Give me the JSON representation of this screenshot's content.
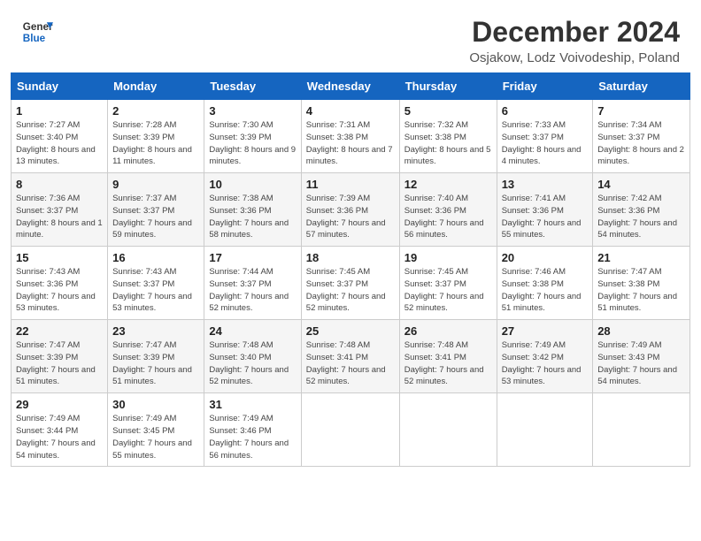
{
  "header": {
    "logo_general": "General",
    "logo_blue": "Blue",
    "title": "December 2024",
    "subtitle": "Osjakow, Lodz Voivodeship, Poland"
  },
  "days_of_week": [
    "Sunday",
    "Monday",
    "Tuesday",
    "Wednesday",
    "Thursday",
    "Friday",
    "Saturday"
  ],
  "weeks": [
    [
      {
        "day": "1",
        "detail": "Sunrise: 7:27 AM\nSunset: 3:40 PM\nDaylight: 8 hours\nand 13 minutes."
      },
      {
        "day": "2",
        "detail": "Sunrise: 7:28 AM\nSunset: 3:39 PM\nDaylight: 8 hours\nand 11 minutes."
      },
      {
        "day": "3",
        "detail": "Sunrise: 7:30 AM\nSunset: 3:39 PM\nDaylight: 8 hours\nand 9 minutes."
      },
      {
        "day": "4",
        "detail": "Sunrise: 7:31 AM\nSunset: 3:38 PM\nDaylight: 8 hours\nand 7 minutes."
      },
      {
        "day": "5",
        "detail": "Sunrise: 7:32 AM\nSunset: 3:38 PM\nDaylight: 8 hours\nand 5 minutes."
      },
      {
        "day": "6",
        "detail": "Sunrise: 7:33 AM\nSunset: 3:37 PM\nDaylight: 8 hours\nand 4 minutes."
      },
      {
        "day": "7",
        "detail": "Sunrise: 7:34 AM\nSunset: 3:37 PM\nDaylight: 8 hours\nand 2 minutes."
      }
    ],
    [
      {
        "day": "8",
        "detail": "Sunrise: 7:36 AM\nSunset: 3:37 PM\nDaylight: 8 hours\nand 1 minute."
      },
      {
        "day": "9",
        "detail": "Sunrise: 7:37 AM\nSunset: 3:37 PM\nDaylight: 7 hours\nand 59 minutes."
      },
      {
        "day": "10",
        "detail": "Sunrise: 7:38 AM\nSunset: 3:36 PM\nDaylight: 7 hours\nand 58 minutes."
      },
      {
        "day": "11",
        "detail": "Sunrise: 7:39 AM\nSunset: 3:36 PM\nDaylight: 7 hours\nand 57 minutes."
      },
      {
        "day": "12",
        "detail": "Sunrise: 7:40 AM\nSunset: 3:36 PM\nDaylight: 7 hours\nand 56 minutes."
      },
      {
        "day": "13",
        "detail": "Sunrise: 7:41 AM\nSunset: 3:36 PM\nDaylight: 7 hours\nand 55 minutes."
      },
      {
        "day": "14",
        "detail": "Sunrise: 7:42 AM\nSunset: 3:36 PM\nDaylight: 7 hours\nand 54 minutes."
      }
    ],
    [
      {
        "day": "15",
        "detail": "Sunrise: 7:43 AM\nSunset: 3:36 PM\nDaylight: 7 hours\nand 53 minutes."
      },
      {
        "day": "16",
        "detail": "Sunrise: 7:43 AM\nSunset: 3:37 PM\nDaylight: 7 hours\nand 53 minutes."
      },
      {
        "day": "17",
        "detail": "Sunrise: 7:44 AM\nSunset: 3:37 PM\nDaylight: 7 hours\nand 52 minutes."
      },
      {
        "day": "18",
        "detail": "Sunrise: 7:45 AM\nSunset: 3:37 PM\nDaylight: 7 hours\nand 52 minutes."
      },
      {
        "day": "19",
        "detail": "Sunrise: 7:45 AM\nSunset: 3:37 PM\nDaylight: 7 hours\nand 52 minutes."
      },
      {
        "day": "20",
        "detail": "Sunrise: 7:46 AM\nSunset: 3:38 PM\nDaylight: 7 hours\nand 51 minutes."
      },
      {
        "day": "21",
        "detail": "Sunrise: 7:47 AM\nSunset: 3:38 PM\nDaylight: 7 hours\nand 51 minutes."
      }
    ],
    [
      {
        "day": "22",
        "detail": "Sunrise: 7:47 AM\nSunset: 3:39 PM\nDaylight: 7 hours\nand 51 minutes."
      },
      {
        "day": "23",
        "detail": "Sunrise: 7:47 AM\nSunset: 3:39 PM\nDaylight: 7 hours\nand 51 minutes."
      },
      {
        "day": "24",
        "detail": "Sunrise: 7:48 AM\nSunset: 3:40 PM\nDaylight: 7 hours\nand 52 minutes."
      },
      {
        "day": "25",
        "detail": "Sunrise: 7:48 AM\nSunset: 3:41 PM\nDaylight: 7 hours\nand 52 minutes."
      },
      {
        "day": "26",
        "detail": "Sunrise: 7:48 AM\nSunset: 3:41 PM\nDaylight: 7 hours\nand 52 minutes."
      },
      {
        "day": "27",
        "detail": "Sunrise: 7:49 AM\nSunset: 3:42 PM\nDaylight: 7 hours\nand 53 minutes."
      },
      {
        "day": "28",
        "detail": "Sunrise: 7:49 AM\nSunset: 3:43 PM\nDaylight: 7 hours\nand 54 minutes."
      }
    ],
    [
      {
        "day": "29",
        "detail": "Sunrise: 7:49 AM\nSunset: 3:44 PM\nDaylight: 7 hours\nand 54 minutes."
      },
      {
        "day": "30",
        "detail": "Sunrise: 7:49 AM\nSunset: 3:45 PM\nDaylight: 7 hours\nand 55 minutes."
      },
      {
        "day": "31",
        "detail": "Sunrise: 7:49 AM\nSunset: 3:46 PM\nDaylight: 7 hours\nand 56 minutes."
      },
      null,
      null,
      null,
      null
    ]
  ]
}
